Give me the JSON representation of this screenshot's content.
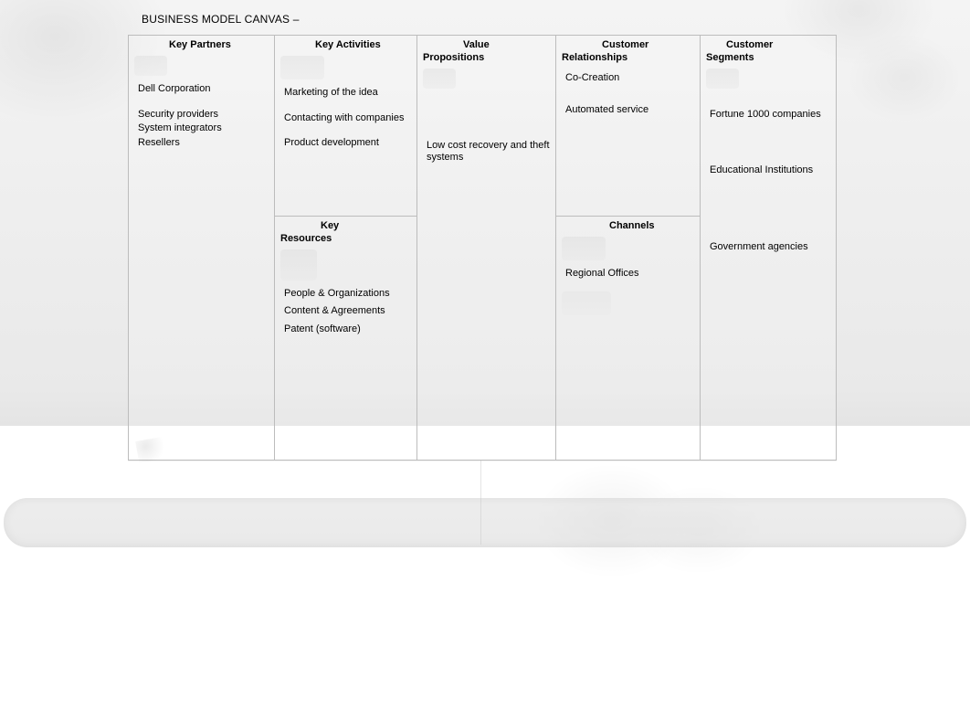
{
  "title": "BUSINESS MODEL CANVAS –",
  "canvas": {
    "key_partners": {
      "header": "Key Partners",
      "items": [
        "Dell Corporation",
        "Security providers",
        "System integrators",
        "Resellers"
      ]
    },
    "key_activities": {
      "header": "Key Activities",
      "items": [
        "Marketing  of the idea",
        "Contacting with companies",
        "Product development"
      ]
    },
    "key_resources": {
      "header": "Key Resources",
      "items": [
        "People & Organizations",
        "Content & Agreements",
        "Patent (software)"
      ]
    },
    "value_propositions": {
      "header": "Value Propositions",
      "items": [
        "Low cost recovery and theft systems"
      ]
    },
    "customer_relationships": {
      "header": "Customer Relationships",
      "items": [
        "Co-Creation",
        "Automated service"
      ]
    },
    "channels": {
      "header": "Channels",
      "items": [
        "Regional Offices"
      ]
    },
    "customer_segments": {
      "header": "Customer Segments",
      "items": [
        "Fortune 1000 companies",
        "Educational Institutions",
        "Government agencies"
      ]
    }
  }
}
